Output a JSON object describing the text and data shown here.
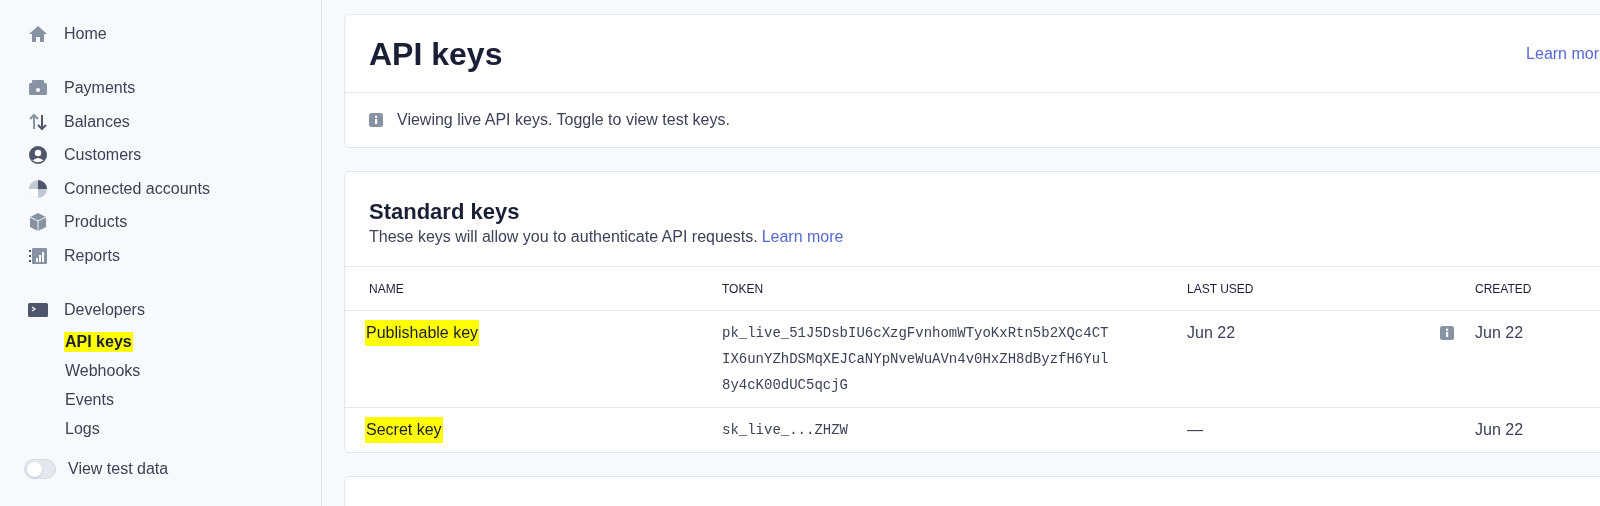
{
  "sidebar": {
    "sections": [
      {
        "items": [
          {
            "label": "Home",
            "kind": "home",
            "selected": false
          }
        ]
      },
      {
        "items": [
          {
            "label": "Payments",
            "kind": "payments",
            "selected": false
          },
          {
            "label": "Balances",
            "kind": "balances",
            "selected": false
          },
          {
            "label": "Customers",
            "kind": "customers",
            "selected": false
          },
          {
            "label": "Connected accounts",
            "kind": "connected",
            "selected": false
          },
          {
            "label": "Products",
            "kind": "products",
            "selected": false
          },
          {
            "label": "Reports",
            "kind": "reports",
            "selected": false
          }
        ]
      },
      {
        "items": [
          {
            "label": "Developers",
            "kind": "developers",
            "selected": false,
            "children": [
              {
                "label": "API keys",
                "selected": true,
                "highlighted": true
              },
              {
                "label": "Webhooks",
                "selected": false,
                "highlighted": false
              },
              {
                "label": "Events",
                "selected": false,
                "highlighted": false
              },
              {
                "label": "Logs",
                "selected": false,
                "highlighted": false
              }
            ]
          }
        ]
      }
    ],
    "test_data_toggle": {
      "label": "View test data",
      "on": false
    }
  },
  "header": {
    "title": "API keys",
    "link": "Learn mor"
  },
  "notice": {
    "text": "Viewing live API keys. Toggle to view test keys."
  },
  "standard_keys": {
    "title": "Standard keys",
    "description": "These keys will allow you to authenticate API requests.",
    "link": "Learn more",
    "columns": [
      "NAME",
      "TOKEN",
      "LAST USED",
      "CREATED"
    ],
    "rows": [
      {
        "name": "Publishable key",
        "highlighted": true,
        "token": "pk_live_51J5DsbIU6cXzgFvnhomWTyoKxRtn5b2XQc4CTIX6unYZhDSMqXEJCaNYpNveWuAVn4v0HxZH8dByzfH6Yul8y4cK00dUC5qcjG",
        "last_used": "Jun 22",
        "info": true,
        "created": "Jun 22"
      },
      {
        "name": "Secret key",
        "highlighted": true,
        "token": "sk_live_...ZHZW",
        "last_used": "—",
        "info": false,
        "created": "Jun 22"
      }
    ]
  }
}
